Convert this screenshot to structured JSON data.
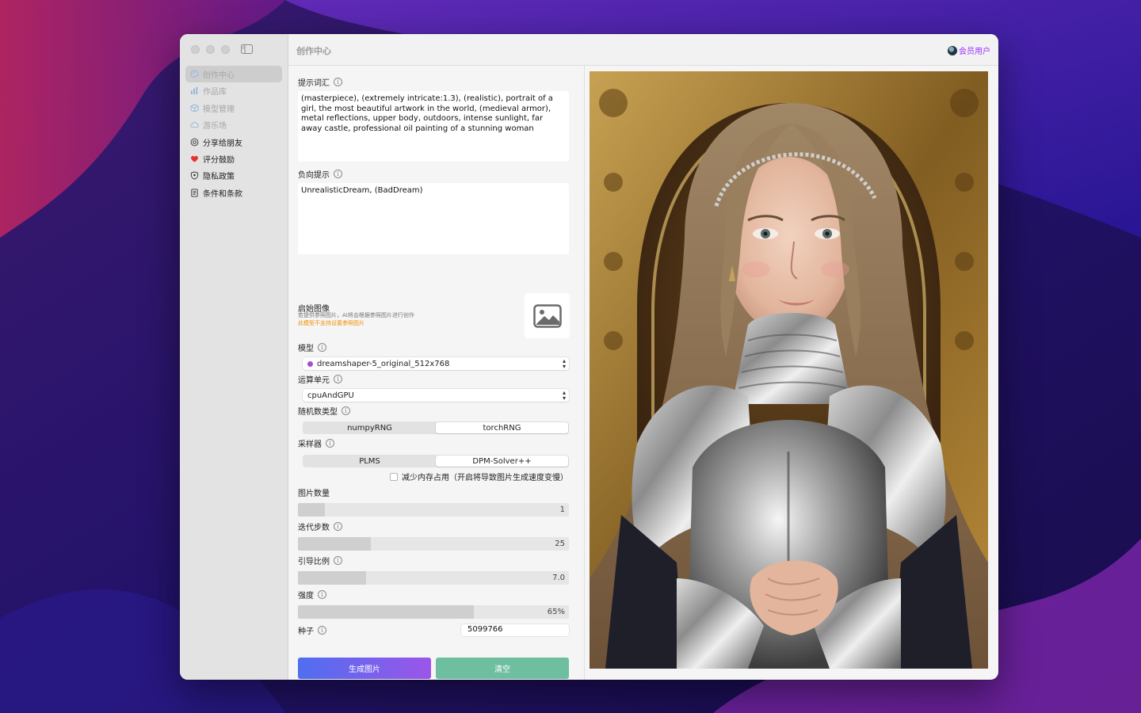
{
  "window": {
    "title": "创作中心"
  },
  "header": {
    "member_label": "会员用户"
  },
  "sidebar": {
    "items": [
      {
        "label": "创作中心",
        "icon": "palette-icon",
        "state": "active"
      },
      {
        "label": "作品库",
        "icon": "chart-icon",
        "state": "dim"
      },
      {
        "label": "模型管理",
        "icon": "cube-icon",
        "state": "dim"
      },
      {
        "label": "游乐场",
        "icon": "cloud-icon",
        "state": "dim"
      },
      {
        "label": "分享给朋友",
        "icon": "share-icon",
        "state": "normal"
      },
      {
        "label": "评分鼓励",
        "icon": "heart-icon",
        "state": "normal"
      },
      {
        "label": "隐私政策",
        "icon": "shield-icon",
        "state": "normal"
      },
      {
        "label": "条件和条款",
        "icon": "document-icon",
        "state": "normal"
      }
    ]
  },
  "form": {
    "prompt": {
      "label": "提示词汇",
      "value": "(masterpiece), (extremely intricate:1.3), (realistic), portrait of a girl, the most beautiful artwork in the world, (medieval armor), metal reflections, upper body, outdoors, intense sunlight, far away castle, professional oil painting of a stunning woman"
    },
    "negative": {
      "label": "负向提示",
      "value": "UnrealisticDream, (BadDream)"
    },
    "init_image": {
      "title": "启始图像",
      "subtitle": "若提供参照图片，AI将会根据参照图片进行创作",
      "warning": "此模型不支持设置参照图片"
    },
    "model": {
      "label": "模型",
      "value": "dreamshaper-5_original_512x768",
      "dot_color": "#a64bd6"
    },
    "compute_unit": {
      "label": "运算单元",
      "value": "cpuAndGPU"
    },
    "rng": {
      "label": "随机数类型",
      "options": [
        "numpyRNG",
        "torchRNG"
      ],
      "selected": "torchRNG"
    },
    "sampler": {
      "label": "采样器",
      "options": [
        "PLMS",
        "DPM-Solver++"
      ],
      "selected": "DPM-Solver++"
    },
    "reduce_memory": {
      "label": "减少内存占用（开启将导致图片生成速度变慢）",
      "checked": false
    },
    "image_count": {
      "label": "图片数量",
      "value": "1",
      "fraction": 0.1
    },
    "steps": {
      "label": "迭代步数",
      "value": "25",
      "fraction": 0.27
    },
    "guidance": {
      "label": "引导比例",
      "value": "7.0",
      "fraction": 0.25
    },
    "strength": {
      "label": "强度",
      "value": "65%",
      "fraction": 0.65
    },
    "seed": {
      "label": "种子",
      "value": "5099766"
    },
    "generate_label": "生成图片",
    "clear_label": "清空"
  },
  "colors": {
    "accent_start": "#4f6ef0",
    "accent_end": "#9b56e8",
    "clear": "#6ebfa0",
    "member": "#9b30ff",
    "warning": "#f29000"
  }
}
